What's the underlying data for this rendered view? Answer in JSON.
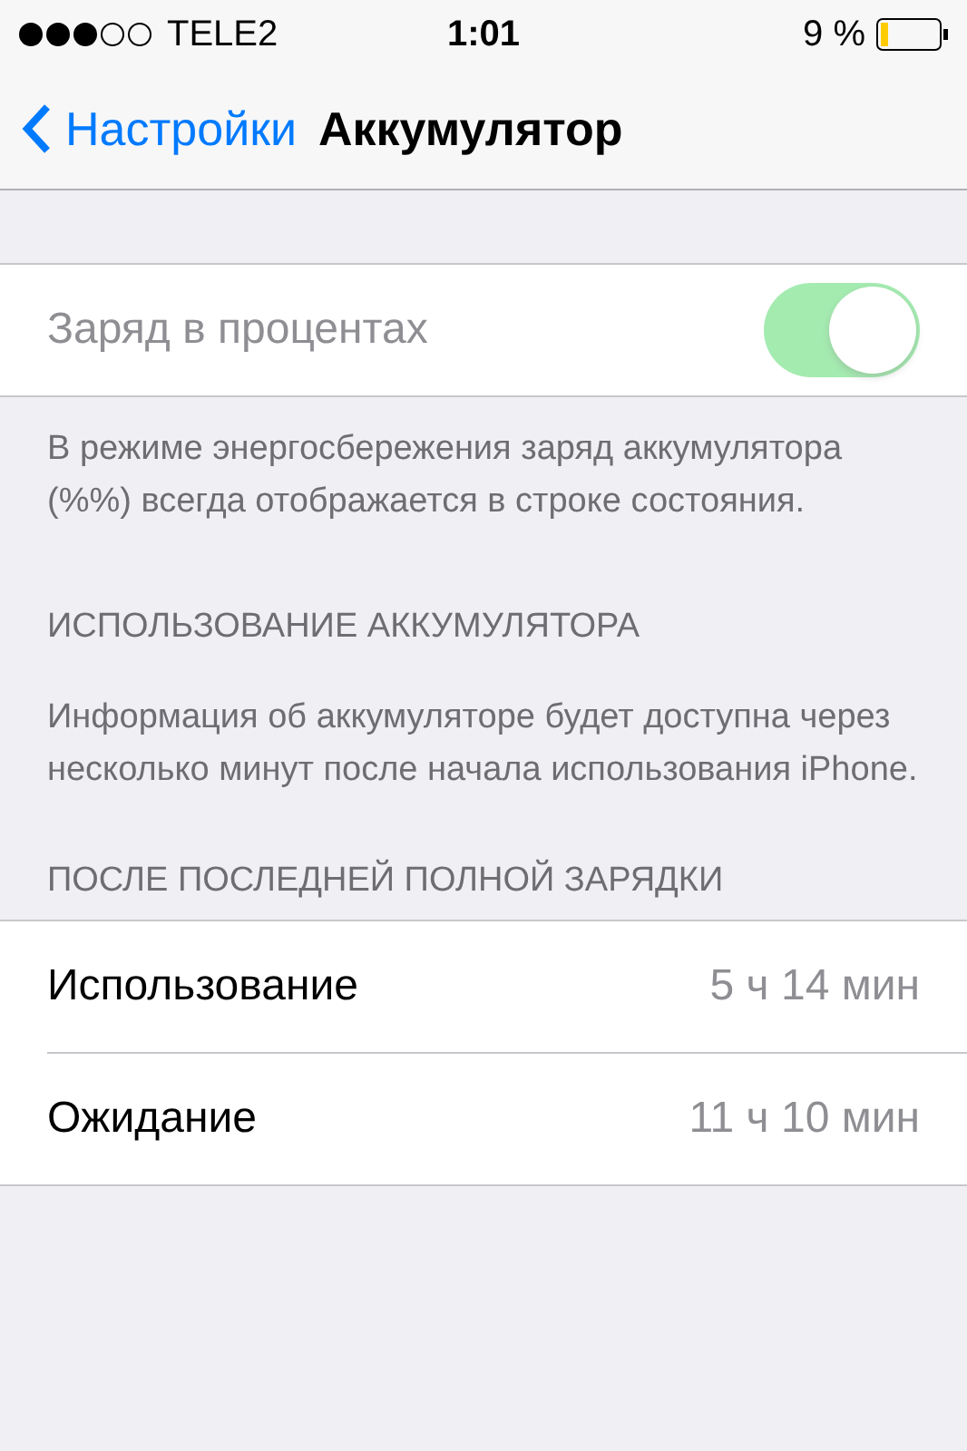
{
  "status_bar": {
    "carrier": "TELE2",
    "time": "1:01",
    "battery": "9 %"
  },
  "nav": {
    "back": "Настройки",
    "title": "Аккумулятор"
  },
  "toggle_row": {
    "label": "Заряд в процентах",
    "on": true,
    "disabled": true
  },
  "toggle_footer": "В режиме энергосбережения заряд аккумулятора (%%) всегда отображается в строке состояния.",
  "usage_section": {
    "header": "ИСПОЛЬЗОВАНИЕ АККУМУЛЯТОРА",
    "footer": "Информация об аккумуляторе будет доступна через несколько минут после начала использования iPhone."
  },
  "since_charge": {
    "header": "ПОСЛЕ ПОСЛЕДНЕЙ ПОЛНОЙ ЗАРЯДКИ",
    "rows": [
      {
        "label": "Использование",
        "value": "5 ч 14 мин"
      },
      {
        "label": "Ожидание",
        "value": "11 ч 10 мин"
      }
    ]
  }
}
